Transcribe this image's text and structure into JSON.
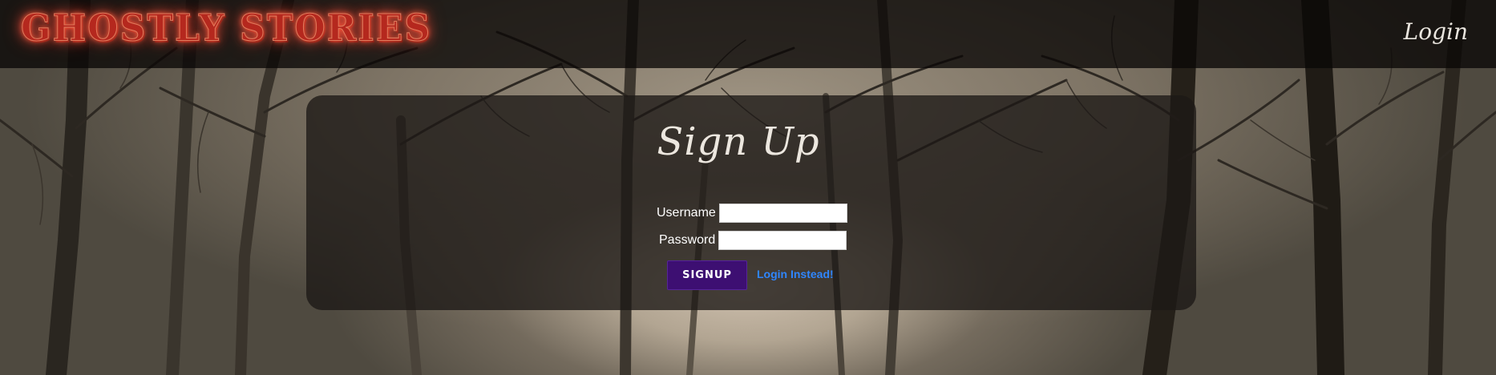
{
  "navbar": {
    "brand": "Ghostly Stories",
    "login_link": "Login"
  },
  "signup_card": {
    "title": "Sign Up",
    "username_label": "Username",
    "username_value": "",
    "password_label": "Password",
    "password_value": "",
    "signup_button": "SIGNUP",
    "login_instead_link": "Login Instead!"
  },
  "colors": {
    "brand_red": "#b5281e",
    "signup_button_bg": "#3d0f72",
    "link_blue": "#2f86ff"
  }
}
